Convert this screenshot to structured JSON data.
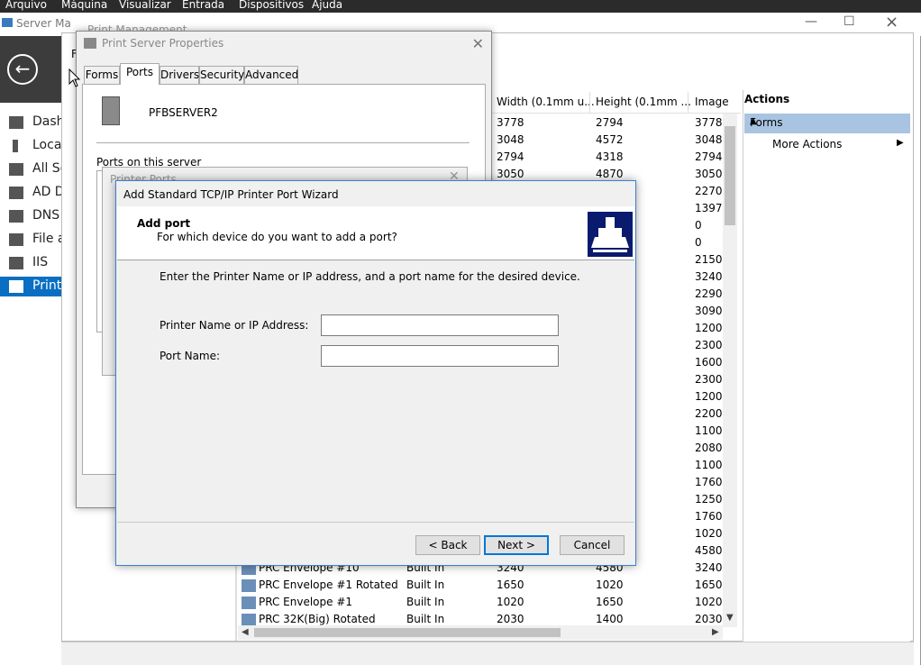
{
  "vm_menu": [
    "Arquivo",
    "Máquina",
    "Visualizar",
    "Entrada",
    "Dispositivos",
    "Ajuda"
  ],
  "server_manager": {
    "title": "Server Ma",
    "sidebar": [
      {
        "label": "Dash",
        "icon": "dashboard-icon"
      },
      {
        "label": "Local",
        "icon": "server-icon"
      },
      {
        "label": "All Se",
        "icon": "servers-icon"
      },
      {
        "label": "AD D",
        "icon": "ad-icon"
      },
      {
        "label": "DNS",
        "icon": "dns-icon"
      },
      {
        "label": "File a",
        "icon": "file-icon"
      },
      {
        "label": "IIS",
        "icon": "iis-icon"
      },
      {
        "label": "Print",
        "icon": "print-icon",
        "selected": true
      }
    ]
  },
  "print_management": {
    "title": "Print Management",
    "menu_letter": "F"
  },
  "table": {
    "columns": [
      "Width (0.1mm u...",
      "Height (0.1mm ...",
      "Image"
    ],
    "rows": [
      {
        "name": "",
        "type": "",
        "width": "3778",
        "height": "2794",
        "image": "3778"
      },
      {
        "name": "",
        "type": "",
        "width": "3048",
        "height": "4572",
        "image": "3048"
      },
      {
        "name": "",
        "type": "",
        "width": "2794",
        "height": "4318",
        "image": "2794"
      },
      {
        "name": "",
        "type": "",
        "width": "3050",
        "height": "4870",
        "image": "3050"
      },
      {
        "name": "",
        "type": "",
        "width": "",
        "height": "",
        "image": "2270"
      },
      {
        "name": "",
        "type": "",
        "width": "",
        "height": "",
        "image": "1397"
      },
      {
        "name": "",
        "type": "",
        "width": "",
        "height": "",
        "image": "0"
      },
      {
        "name": "",
        "type": "",
        "width": "",
        "height": "",
        "image": "0"
      },
      {
        "name": "",
        "type": "",
        "width": "",
        "height": "",
        "image": "2150"
      },
      {
        "name": "",
        "type": "",
        "width": "",
        "height": "",
        "image": "3240"
      },
      {
        "name": "",
        "type": "",
        "width": "",
        "height": "",
        "image": "2290"
      },
      {
        "name": "",
        "type": "",
        "width": "",
        "height": "",
        "image": "3090"
      },
      {
        "name": "",
        "type": "",
        "width": "",
        "height": "",
        "image": "1200"
      },
      {
        "name": "",
        "type": "",
        "width": "",
        "height": "",
        "image": "2300"
      },
      {
        "name": "",
        "type": "",
        "width": "",
        "height": "",
        "image": "1600"
      },
      {
        "name": "",
        "type": "",
        "width": "",
        "height": "",
        "image": "2300"
      },
      {
        "name": "",
        "type": "",
        "width": "",
        "height": "",
        "image": "1200"
      },
      {
        "name": "",
        "type": "",
        "width": "",
        "height": "",
        "image": "2200"
      },
      {
        "name": "",
        "type": "",
        "width": "",
        "height": "",
        "image": "1100"
      },
      {
        "name": "",
        "type": "",
        "width": "",
        "height": "",
        "image": "2080"
      },
      {
        "name": "",
        "type": "",
        "width": "",
        "height": "",
        "image": "1100"
      },
      {
        "name": "",
        "type": "",
        "width": "",
        "height": "",
        "image": "1760"
      },
      {
        "name": "",
        "type": "",
        "width": "",
        "height": "",
        "image": "1250"
      },
      {
        "name": "",
        "type": "",
        "width": "",
        "height": "",
        "image": "1760"
      },
      {
        "name": "",
        "type": "",
        "width": "",
        "height": "",
        "image": "1020"
      },
      {
        "name": "",
        "type": "",
        "width": "",
        "height": "",
        "image": "4580"
      },
      {
        "name": "PRC Envelope #10",
        "type": "Built In",
        "width": "3240",
        "height": "4580",
        "image": "3240"
      },
      {
        "name": "PRC Envelope #1 Rotated",
        "type": "Built In",
        "width": "1650",
        "height": "1020",
        "image": "1650"
      },
      {
        "name": "PRC Envelope #1",
        "type": "Built In",
        "width": "1020",
        "height": "1650",
        "image": "1020"
      },
      {
        "name": "PRC 32K(Big) Rotated",
        "type": "Built In",
        "width": "2030",
        "height": "1400",
        "image": "2030"
      }
    ]
  },
  "actions": {
    "title": "Actions",
    "section": "Forms",
    "more": "More Actions"
  },
  "print_server_properties": {
    "title": "Print Server Properties",
    "tabs": [
      "Forms",
      "Ports",
      "Drivers",
      "Security",
      "Advanced"
    ],
    "active_tab": "Ports",
    "server_name": "PFBSERVER2",
    "ports_label": "Ports on this server",
    "ports_dialog_title": "Printer Ports"
  },
  "wizard": {
    "title": "Add Standard TCP/IP Printer Port Wizard",
    "header_title": "Add port",
    "header_subtitle": "For which device do you want to add a port?",
    "instruction": "Enter the Printer Name or IP address, and a port name for the desired device.",
    "field1_label": "Printer Name or IP Address:",
    "field1_value": "",
    "field2_label": "Port Name:",
    "field2_value": "",
    "back": "< Back",
    "next": "Next >",
    "cancel": "Cancel"
  }
}
